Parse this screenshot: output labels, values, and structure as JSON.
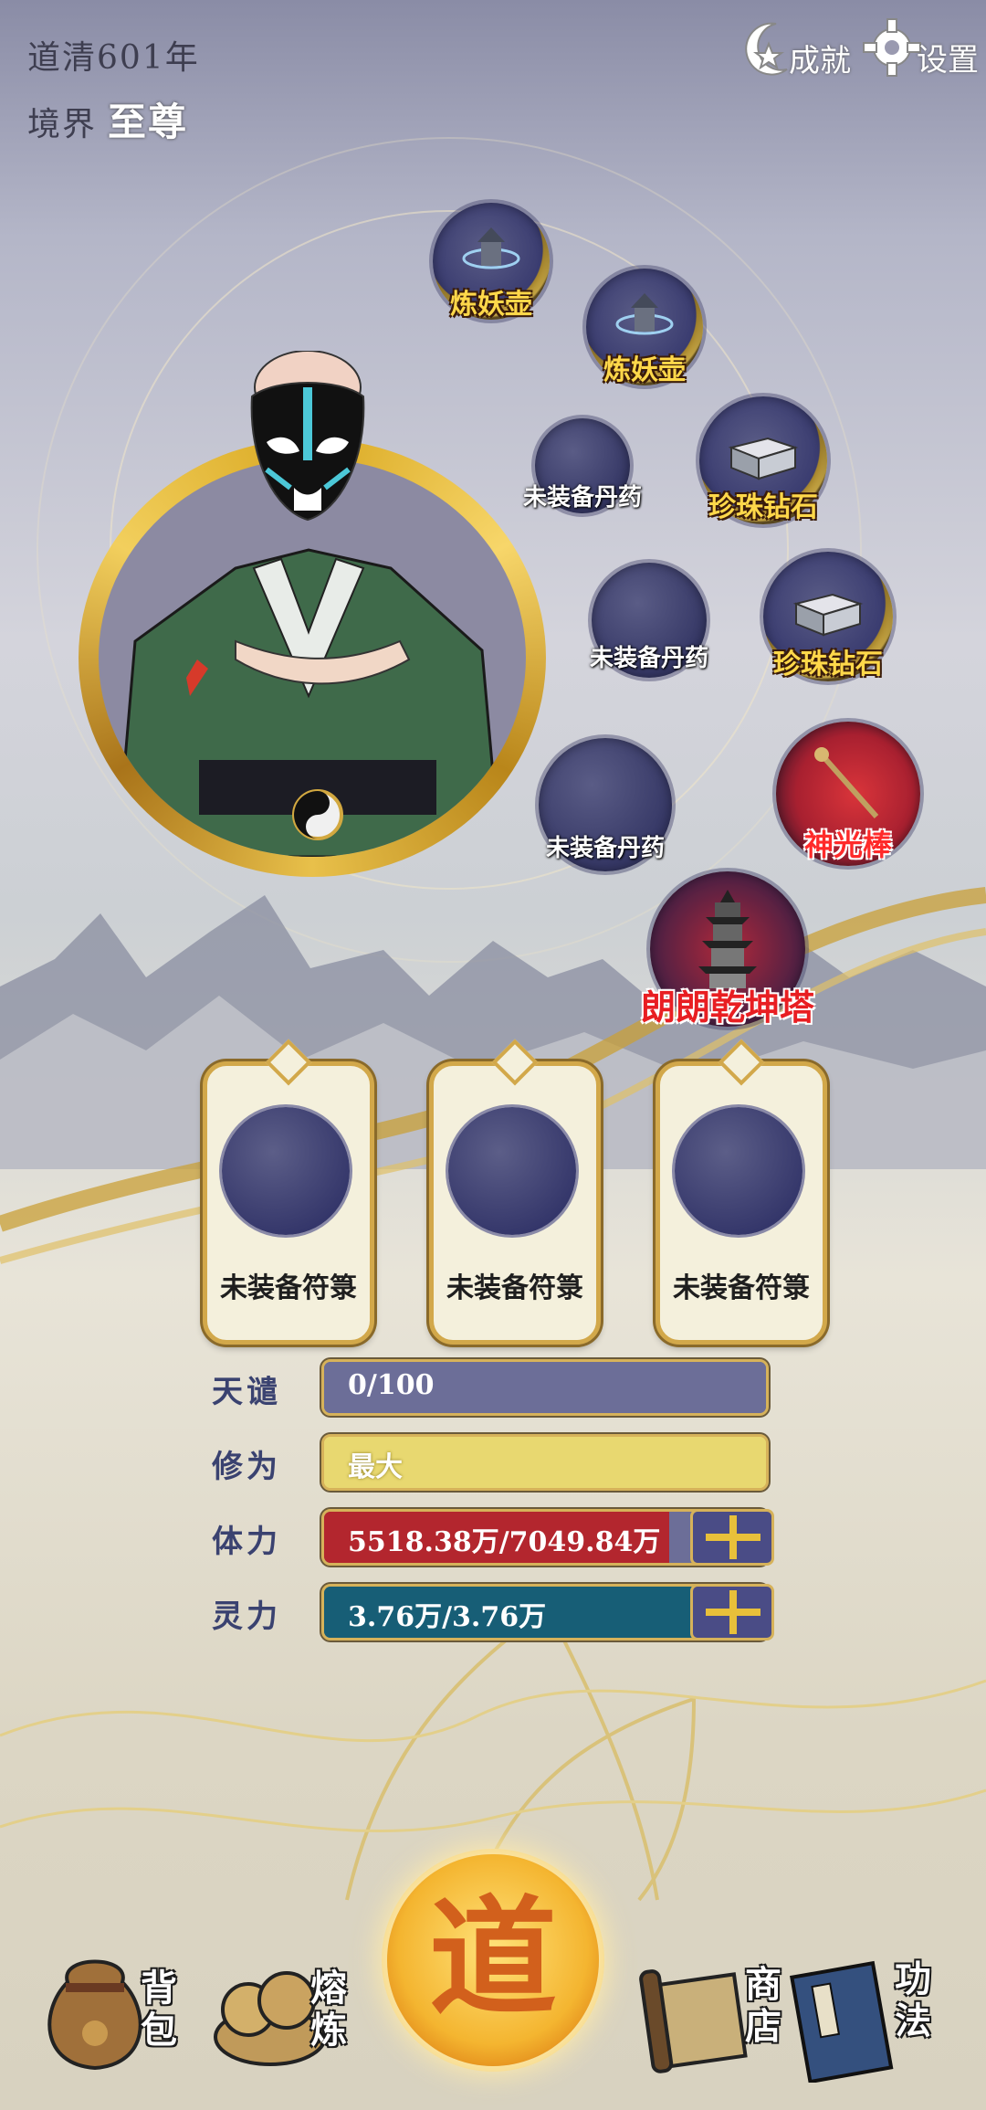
{
  "status": {
    "year_label": "道清601年",
    "realm_label": "境界",
    "realm_value": "至尊"
  },
  "top_buttons": {
    "achievements": "成就",
    "settings": "设置"
  },
  "equipment_slots": [
    {
      "label": "炼妖壶",
      "style": "gold",
      "icon": "pagoda-pot-icon"
    },
    {
      "label": "炼妖壶",
      "style": "gold",
      "icon": "pagoda-pot-icon"
    },
    {
      "label": "未装备丹药",
      "style": "empty"
    },
    {
      "label": "珍珠钻石",
      "style": "gold",
      "icon": "gem-crate-icon"
    },
    {
      "label": "未装备丹药",
      "style": "empty"
    },
    {
      "label": "珍珠钻石",
      "style": "gold",
      "icon": "gem-crate-icon"
    },
    {
      "label": "未装备丹药",
      "style": "empty"
    },
    {
      "label": "神光棒",
      "style": "red",
      "icon": "staff-icon"
    },
    {
      "label": "朗朗乾坤塔",
      "style": "dark",
      "icon": "pagoda-tower-icon"
    }
  ],
  "talismans": [
    {
      "label": "未装备符箓"
    },
    {
      "label": "未装备符箓"
    },
    {
      "label": "未装备符箓"
    }
  ],
  "stats": {
    "tianqian": {
      "label": "天谴",
      "value": "0/100",
      "fill": 1.0,
      "color": "#6c6e98"
    },
    "xiuwei": {
      "label": "修为",
      "value": "最大",
      "fill": 1.0,
      "color": "#e8d870"
    },
    "tili": {
      "label": "体力",
      "value": "5518.38万/7049.84万",
      "fill": 0.78,
      "color": "#b3262e"
    },
    "lingli": {
      "label": "灵力",
      "value": "3.76万/3.76万",
      "fill": 1.0,
      "color": "#175e76"
    }
  },
  "center_button": {
    "glyph": "道"
  },
  "bottom_nav": {
    "backpack": "背包",
    "smelt": "熔炼",
    "shop": "商店",
    "skills": "功法"
  }
}
